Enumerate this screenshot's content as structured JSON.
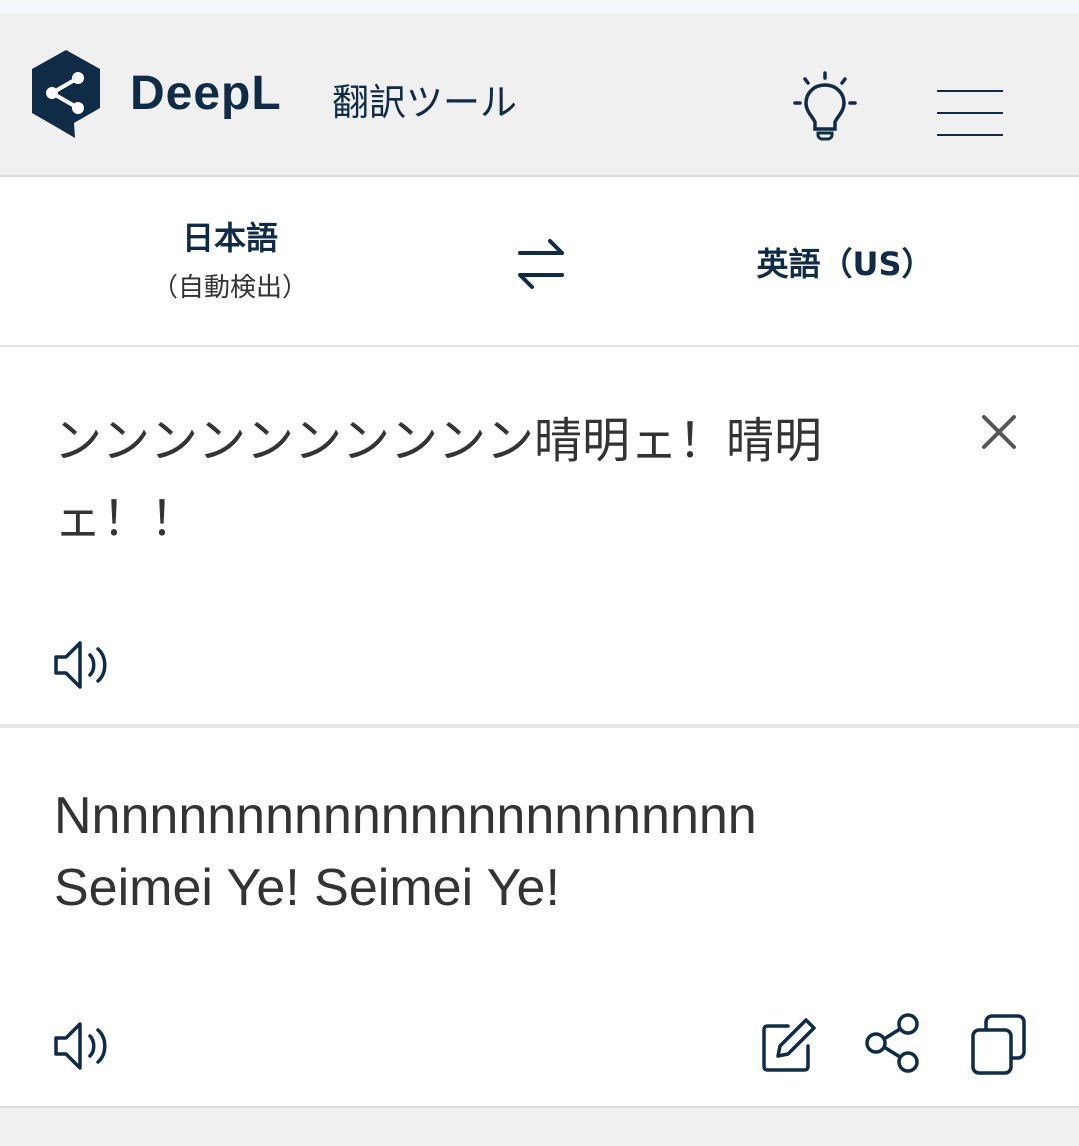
{
  "header": {
    "brand": "DeepL",
    "subtitle": "翻訳ツール",
    "brand_color": "#0f2b46",
    "icons": [
      "deepl-logo-icon",
      "lightbulb-icon",
      "hamburger-menu-icon"
    ]
  },
  "languages": {
    "source_main": "日本語",
    "source_sub": "（自動検出）",
    "target": "英語（US）",
    "swap_icon": "swap-arrows-icon"
  },
  "source": {
    "text": "ンンンンンンンンンン晴明ェ！晴明ェ！！",
    "clear_icon": "close-icon",
    "speaker_icon": "speaker-icon"
  },
  "target": {
    "line1": "Nnnnnnnnnnnnnnnnnnnnnnnn",
    "line2": "Seimei Ye! Seimei Ye!",
    "icons": [
      "speaker-icon",
      "edit-pencil-icon",
      "share-icon",
      "copy-icon"
    ]
  }
}
